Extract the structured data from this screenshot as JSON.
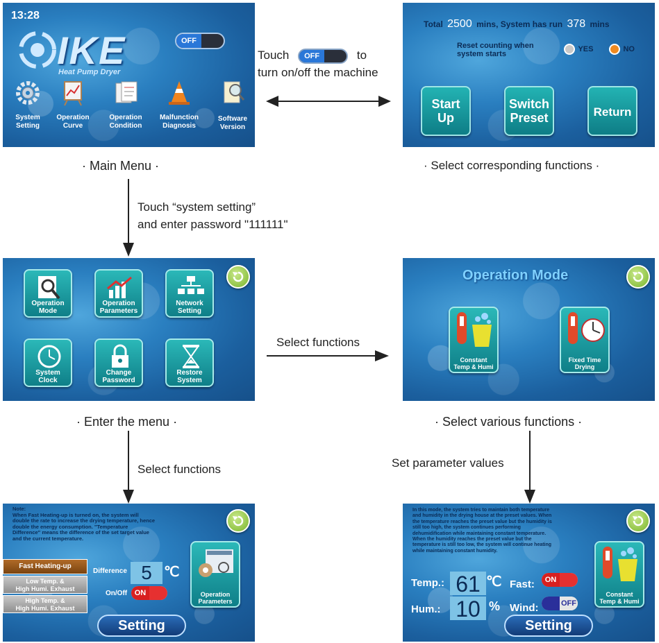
{
  "main_menu": {
    "time": "13:28",
    "logo": "IKE",
    "subtitle": "Heat Pump Dryer",
    "toggle_label": "OFF",
    "items": [
      {
        "label_1": "System",
        "label_2": "Setting",
        "icon": "gear-icon"
      },
      {
        "label_1": "Operation",
        "label_2": "Curve",
        "icon": "chart-easel-icon"
      },
      {
        "label_1": "Operation",
        "label_2": "Condition",
        "icon": "clipboard-icon"
      },
      {
        "label_1": "Malfunction",
        "label_2": "Diagnosis",
        "icon": "traffic-cone-icon"
      },
      {
        "label_1": "Software",
        "label_2": "Version",
        "icon": "document-search-icon"
      }
    ],
    "caption": "· Main Menu ·"
  },
  "toggle_note": {
    "line1_pre": "Touch",
    "toggle_label": "OFF",
    "line1_post": "to",
    "line2": "turn on/off the machine"
  },
  "startup_screen": {
    "total_label": "Total",
    "total_value": "2500",
    "run_label": "mins, System has run",
    "run_value": "378",
    "run_unit": "mins",
    "reset_line1": "Reset counting when",
    "reset_line2": "system starts",
    "yes_label": "YES",
    "no_label": "NO",
    "start_1": "Start",
    "start_2": "Up",
    "switch_1": "Switch",
    "switch_2": "Preset",
    "return_label": "Return",
    "caption": "· Select corresponding functions ·"
  },
  "step1": {
    "line1": "Touch “system setting”",
    "line2": "and enter password \"111111\""
  },
  "settings_menu": {
    "tiles": [
      {
        "l1": "Operation",
        "l2": "Mode",
        "icon": "search-icon"
      },
      {
        "l1": "Operation",
        "l2": "Parameters",
        "icon": "trend-chart-icon"
      },
      {
        "l1": "Network",
        "l2": "Setting",
        "icon": "network-icon"
      },
      {
        "l1": "System",
        "l2": "Clock",
        "icon": "clock-icon"
      },
      {
        "l1": "Change",
        "l2": "Password",
        "icon": "lock-icon"
      },
      {
        "l1": "Restore",
        "l2": "System",
        "icon": "hourglass-icon"
      }
    ],
    "caption": "· Enter the menu ·"
  },
  "select_functions_1": "Select functions",
  "operation_mode": {
    "title": "Operation Mode",
    "opt1_l1": "Constant",
    "opt1_l2": "Temp & Humi",
    "opt2_l1": "Fixed Time",
    "opt2_l2": "Drying",
    "caption": "· Select various functions ·"
  },
  "select_functions_2": "Select functions",
  "set_parameter_values": "Set parameter values",
  "fast_heat": {
    "note": [
      "Note:",
      "When Fast Heating-up is turned on, the system will",
      "double the rate to increase the drying temperature, hence",
      "double the energy consumption. \"Temperature",
      "Difference\" means the difference of the set target value",
      "and the current temperature."
    ],
    "menu": [
      {
        "l1": "Fast Heating-up",
        "l2": ""
      },
      {
        "l1": "Low Temp. &",
        "l2": "High Humi. Exhaust"
      },
      {
        "l1": "High Temp. &",
        "l2": "High Humi. Exhaust"
      }
    ],
    "difference_label": "Difference",
    "difference_value": "5",
    "difference_unit": "℃",
    "onoff_label": "On/Off",
    "onoff_value": "ON",
    "side_l1": "Operation",
    "side_l2": "Parameters",
    "setting": "Setting"
  },
  "constant_mode": {
    "note": [
      "In this mode, the system tries to maintain both temperature",
      "and humidity in the drying house at the preset values. When",
      "the temperature reaches the preset value but the humidity is",
      "still too high, the system continues performing",
      "dehumidification while maintaining constant temperature.",
      "When the humidity reaches the preset value but the",
      "temperature is still too low, the system will continue heating",
      "while maintaining constant humidity."
    ],
    "temp_label": "Temp.:",
    "temp_value": "61",
    "temp_unit": "℃",
    "hum_label": "Hum.:",
    "hum_value": "10",
    "hum_unit": "%",
    "fast_label": "Fast:",
    "fast_value": "ON",
    "wind_label": "Wind:",
    "wind_value": "OFF",
    "side_l1": "Constant",
    "side_l2": "Temp & Humi",
    "setting": "Setting"
  }
}
